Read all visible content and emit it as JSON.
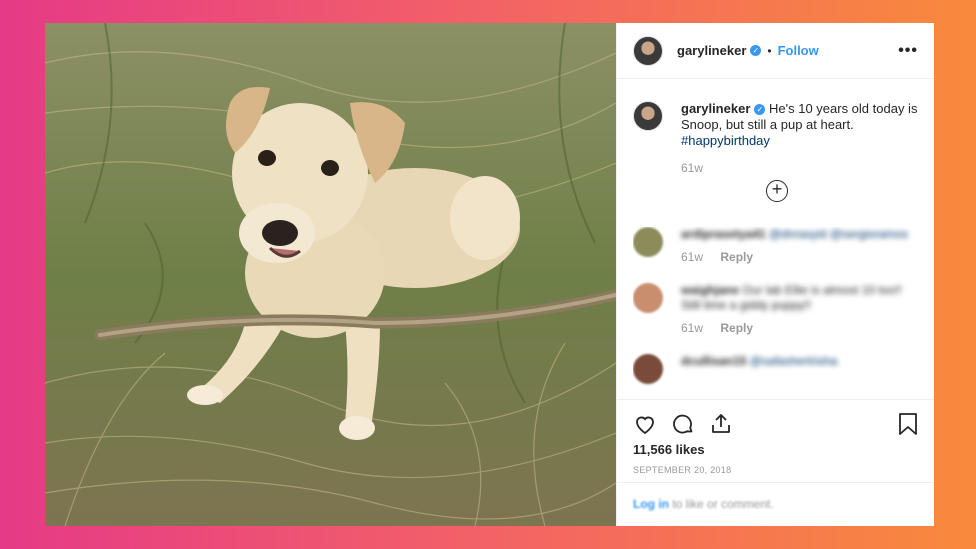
{
  "post": {
    "username": "garylineker",
    "follow_label": "Follow",
    "dot": "•",
    "more_label": "•••",
    "caption_main": "He's 10 years old today is Snoop, but still a pup at heart.",
    "hashtag": "#happybirthday",
    "age": "61w",
    "likes": "11,566 likes",
    "date": "SEPTEMBER 20, 2018"
  },
  "comments": [
    {
      "user": "ardiprasetya41",
      "text": "",
      "mention": "@dnrasyid @sergioramos",
      "age": "61w",
      "reply": "Reply",
      "avatar_color": "#8c8c5a"
    },
    {
      "user": "waighjane",
      "text": "Our lab Ellie is almost 10 too!! Still time a giddy puppy!!",
      "mention": "",
      "age": "61w",
      "reply": "Reply",
      "avatar_color": "#c98e6e"
    },
    {
      "user": "dcullisan15",
      "text": "",
      "mention": "@safashertrisha",
      "age": "",
      "reply": "",
      "avatar_color": "#7a4b3a"
    }
  ],
  "footer": {
    "login_label": "Log in",
    "login_rest": " to like or comment."
  },
  "icons": [
    "heart-icon",
    "comment-icon",
    "share-icon",
    "bookmark-icon",
    "add-circle-icon",
    "verified-icon"
  ],
  "colors": {
    "accent": "#3897f0",
    "hashtag": "#00376b",
    "muted": "#999999"
  }
}
